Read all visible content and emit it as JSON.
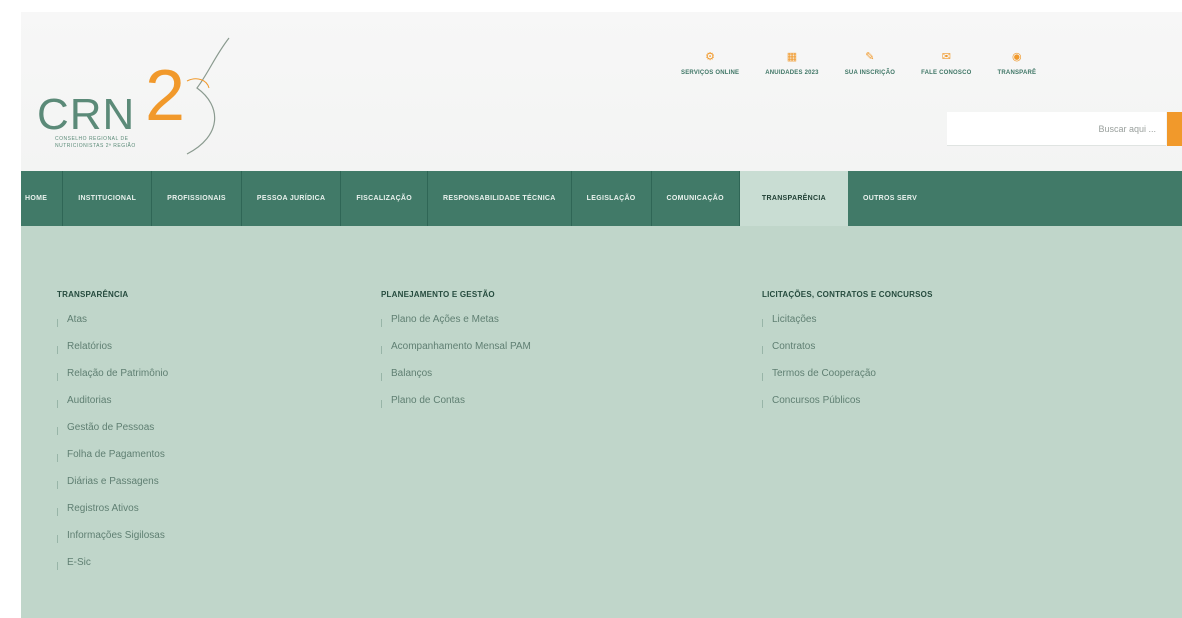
{
  "logo": {
    "text": "CRN",
    "number": "2",
    "subtitle": "Conselho Regional de Nutricionistas 2ª Região"
  },
  "top_links": [
    {
      "label": "Serviços Online",
      "icon": "services-icon"
    },
    {
      "label": "Anuidades 2023",
      "icon": "calendar-icon"
    },
    {
      "label": "Sua Inscrição",
      "icon": "pencil-icon"
    },
    {
      "label": "Fale Conosco",
      "icon": "chat-icon"
    },
    {
      "label": "Transparê",
      "icon": "transparency-icon"
    }
  ],
  "search": {
    "placeholder": "Buscar aqui ..."
  },
  "nav": [
    "Home",
    "Institucional",
    "Profissionais",
    "Pessoa Jurídica",
    "Fiscalização",
    "Responsabilidade Técnica",
    "Legislação",
    "Comunicação",
    "Transparência",
    "Outros Serv"
  ],
  "nav_active": "Transparência",
  "menu": {
    "col1": {
      "title": "Transparência",
      "items": [
        "Atas",
        "Relatórios",
        "Relação de Patrimônio",
        "Auditorias",
        "Gestão de Pessoas",
        "Folha de Pagamentos",
        "Diárias e Passagens",
        "Registros Ativos",
        "Informações Sigilosas",
        "E-Sic"
      ]
    },
    "col2": {
      "title": "Planejamento e Gestão",
      "items": [
        "Plano de Ações e Metas",
        "Acompanhamento Mensal PAM",
        "Balanços",
        "Plano de Contas"
      ]
    },
    "col3": {
      "title": "Licitações, Contratos e Concursos",
      "items": [
        "Licitações",
        "Contratos",
        "Termos de Cooperação",
        "Concursos Públicos"
      ]
    }
  },
  "colors": {
    "brand_green": "#417a68",
    "accent_orange": "#f1992b",
    "menu_bg": "#c0d6ca"
  }
}
